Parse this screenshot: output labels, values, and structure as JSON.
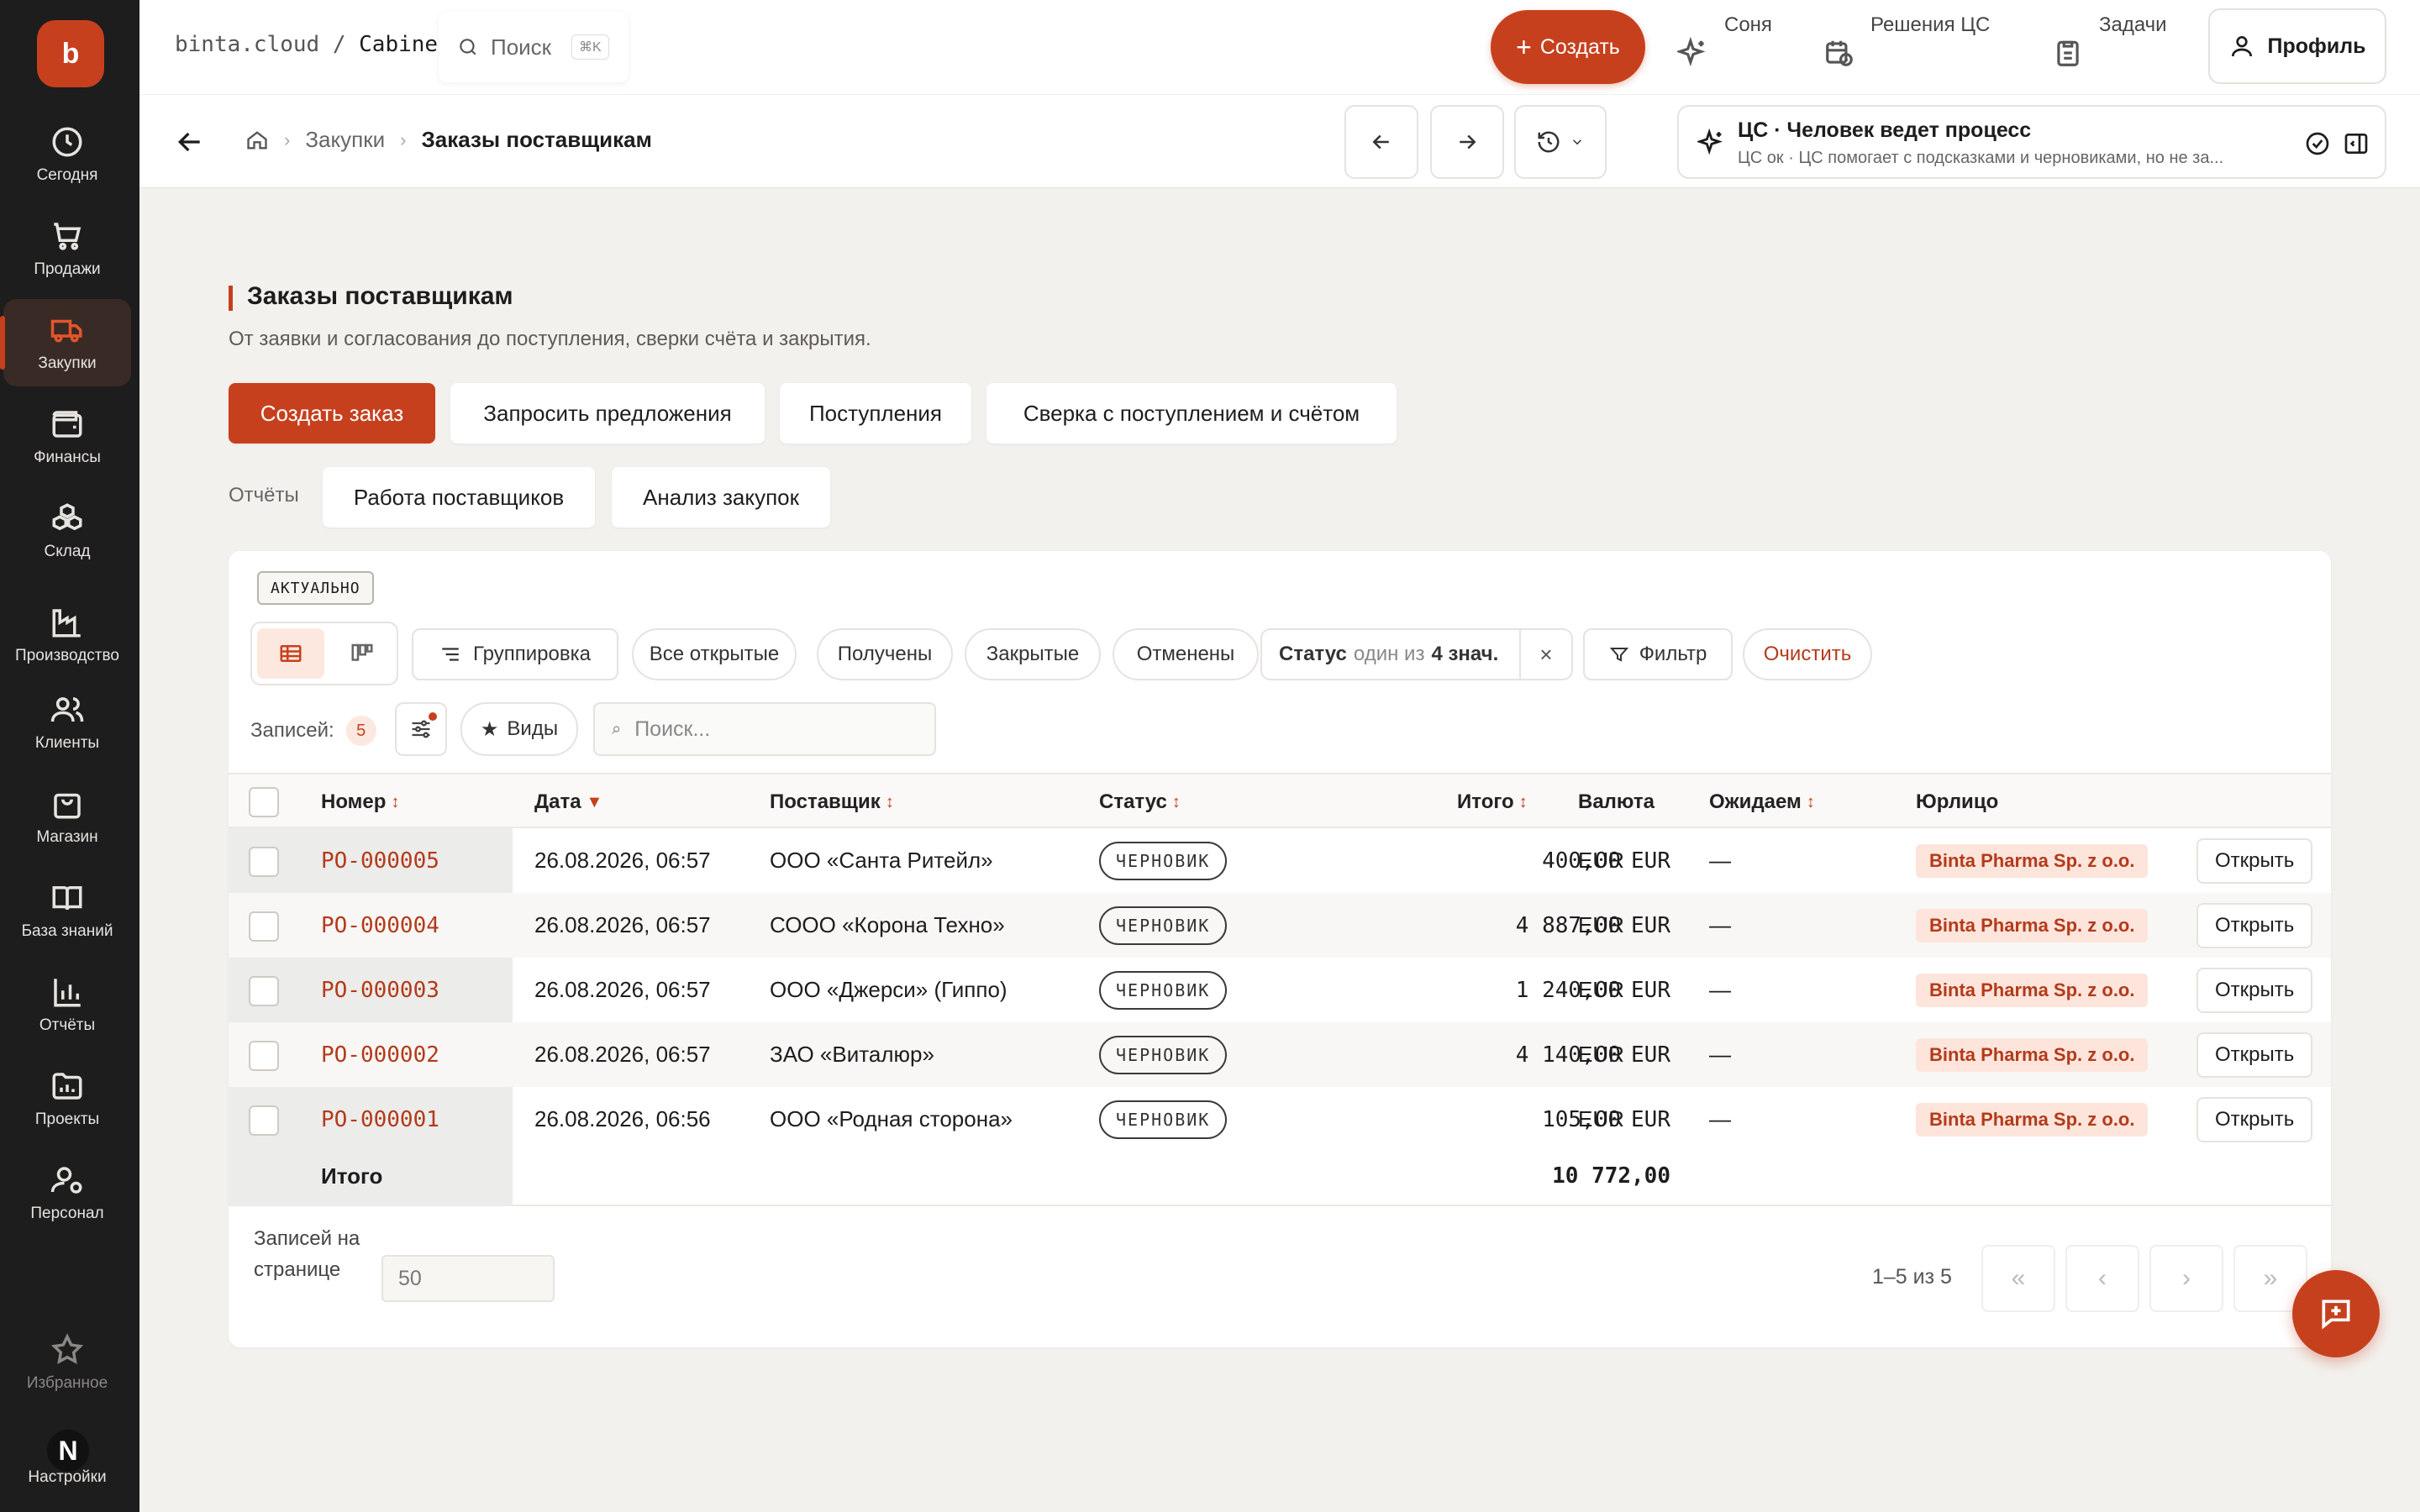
{
  "app": {
    "logo_letter": "b",
    "domain": "binta.cloud",
    "path_sep": "/",
    "path_cur": "Cabinet"
  },
  "sidebar": {
    "items": [
      {
        "label": "Сегодня",
        "icon": "clock-icon"
      },
      {
        "label": "Продажи",
        "icon": "cart-icon"
      },
      {
        "label": "Закупки",
        "icon": "truck-icon",
        "active": true
      },
      {
        "label": "Финансы",
        "icon": "wallet-icon"
      },
      {
        "label": "Склад",
        "icon": "boxes-icon"
      },
      {
        "label": "Производство",
        "icon": "factory-icon"
      },
      {
        "label": "Клиенты",
        "icon": "users-icon"
      },
      {
        "label": "Магазин",
        "icon": "bag-icon"
      },
      {
        "label": "База знаний",
        "icon": "book-icon"
      },
      {
        "label": "Отчёты",
        "icon": "bar-chart-icon"
      },
      {
        "label": "Проекты",
        "icon": "folder-chart-icon"
      },
      {
        "label": "Персонал",
        "icon": "user-gear-icon"
      },
      {
        "label": "Избранное",
        "icon": "star-icon"
      },
      {
        "label": "Настройки",
        "icon": "settings-icon"
      }
    ],
    "avatar_letter": "N"
  },
  "topbar": {
    "search_label": "Поиск",
    "search_kbd": "⌘K",
    "create_label": "Создать",
    "tools": [
      {
        "label": "Соня",
        "icon": "sparkle-icon"
      },
      {
        "label": "Решения ЦС",
        "icon": "calendar-clock-icon"
      },
      {
        "label": "Задачи",
        "icon": "clipboard-icon"
      }
    ],
    "profile_label": "Профиль"
  },
  "subbar": {
    "breadcrumb": [
      "Закупки",
      "Заказы поставщикам"
    ],
    "cs_title": "ЦС · Человек ведет процесс",
    "cs_subtitle": "ЦС ок · ЦС помогает с подсказками и черновиками, но не за..."
  },
  "page": {
    "title": "Заказы поставщикам",
    "subtitle": "От заявки и согласования до поступления, сверки счёта и закрытия.",
    "actions": [
      "Создать заказ",
      "Запросить предложения",
      "Поступления",
      "Сверка с поступлением и счётом"
    ],
    "reports_label": "Отчёты",
    "reports": [
      "Работа поставщиков",
      "Анализ закупок"
    ]
  },
  "list": {
    "badge": "АКТУАЛЬНО",
    "grouping_label": "Группировка",
    "chips": [
      "Все открытые",
      "Получены",
      "Закрытые",
      "Отменены"
    ],
    "status_filter": {
      "key": "Статус",
      "op": "один из",
      "value": "4 знач."
    },
    "filter_label": "Фильтр",
    "clear_label": "Очистить",
    "records_label": "Записей:",
    "records_count": "5",
    "views_label": "Виды",
    "search_placeholder": "Поиск..."
  },
  "table": {
    "columns": [
      "Номер",
      "Дата",
      "Поставщик",
      "Статус",
      "Итого",
      "Валюта",
      "Ожидаем",
      "Юрлицо"
    ],
    "rows": [
      {
        "number": "PO-000005",
        "date": "26.08.2026, 06:57",
        "supplier": "ООО «Санта Ритейл»",
        "status": "ЧЕРНОВИК",
        "total": "400,00",
        "total_cur": "EUR",
        "currency": "EUR",
        "expected": "—",
        "entity": "Binta Pharma Sp. z o.o.",
        "action": "Открыть"
      },
      {
        "number": "PO-000004",
        "date": "26.08.2026, 06:57",
        "supplier": "СООО «Корона Техно»",
        "status": "ЧЕРНОВИК",
        "total": "4 887,00",
        "total_cur": "EUR",
        "currency": "EUR",
        "expected": "—",
        "entity": "Binta Pharma Sp. z o.o.",
        "action": "Открыть"
      },
      {
        "number": "PO-000003",
        "date": "26.08.2026, 06:57",
        "supplier": "ООО «Джерси» (Гиппо)",
        "status": "ЧЕРНОВИК",
        "total": "1 240,00",
        "total_cur": "EUR",
        "currency": "EUR",
        "expected": "—",
        "entity": "Binta Pharma Sp. z o.o.",
        "action": "Открыть"
      },
      {
        "number": "PO-000002",
        "date": "26.08.2026, 06:57",
        "supplier": "ЗАО «Виталюр»",
        "status": "ЧЕРНОВИК",
        "total": "4 140,00",
        "total_cur": "EUR",
        "currency": "EUR",
        "expected": "—",
        "entity": "Binta Pharma Sp. z o.o.",
        "action": "Открыть"
      },
      {
        "number": "PO-000001",
        "date": "26.08.2026, 06:56",
        "supplier": "ООО «Родная сторона»",
        "status": "ЧЕРНОВИК",
        "total": "105,00",
        "total_cur": "EUR",
        "currency": "EUR",
        "expected": "—",
        "entity": "Binta Pharma Sp. z o.o.",
        "action": "Открыть"
      }
    ],
    "total_label": "Итого",
    "total_value": "10 772,00"
  },
  "pager": {
    "per_page_label": "Записей на странице",
    "per_page_value": "50",
    "range": "1–5 из 5"
  },
  "colors": {
    "accent": "#c7401d",
    "sidebar_bg": "#1d1d1d",
    "page_bg": "#f3f1ee"
  }
}
